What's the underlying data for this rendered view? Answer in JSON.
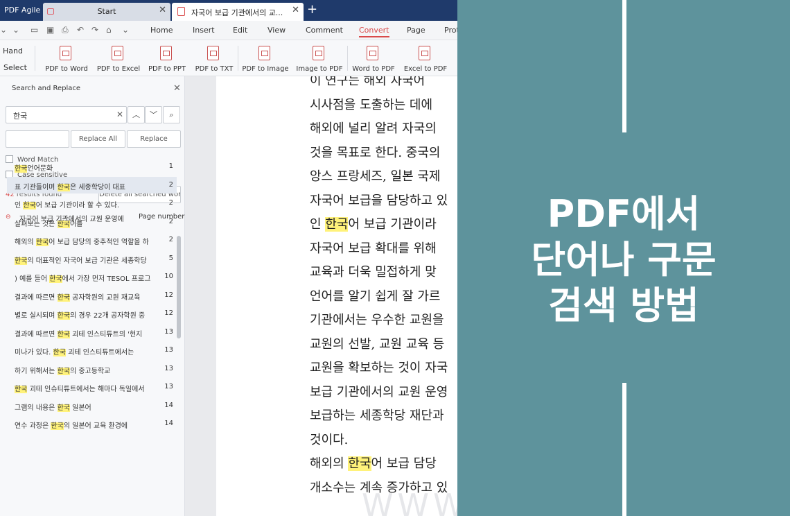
{
  "titlebar": {
    "app_name": "PDF Agile",
    "tabs": [
      {
        "label": "Start"
      },
      {
        "label": "자국어 보급 기관에서의 교..."
      }
    ]
  },
  "menubar": {
    "items": [
      "Home",
      "Insert",
      "Edit",
      "View",
      "Comment",
      "Convert",
      "Page",
      "Prot"
    ],
    "active": "Convert"
  },
  "ribbon": {
    "hand_label": "Hand",
    "select_label": "Select",
    "tools": [
      "PDF to Word",
      "PDF to Excel",
      "PDF to PPT",
      "PDF to TXT",
      "PDF to Image",
      "Image to PDF",
      "Word to PDF",
      "Excel to PDF"
    ]
  },
  "search_panel": {
    "title": "Search and Replace",
    "query": "한국",
    "replace_all_label": "Replace All",
    "replace_label": "Replace",
    "word_match_label": "Word Match",
    "case_sensitive_label": "Case sensitive",
    "results_num": "42",
    "results_suffix": " results found",
    "delete_label": "Delete all searched words",
    "group_name": "자국어 보급 기관에서의 교원 운영에",
    "page_header": "Page number",
    "results": [
      {
        "before": "",
        "match": "한국",
        "after": "언어문화",
        "page": "1"
      },
      {
        "before": "표 기관들이며 ",
        "match": "한국",
        "after": "은 세종학당이 대표",
        "page": "2"
      },
      {
        "before": "인 ",
        "match": "한국",
        "after": "어 보급 기관이라 할 수 있다.",
        "page": "2"
      },
      {
        "before": "살펴보는 것은 ",
        "match": "한국",
        "after": "어를",
        "page": "2"
      },
      {
        "before": "해외의 ",
        "match": "한국",
        "after": "어 보급 담당의 중추적인 역할을 하",
        "page": "2"
      },
      {
        "before": "",
        "match": "한국",
        "after": "의 대표적인 자국어 보급 기관은 세종학당",
        "page": "5"
      },
      {
        "before": ") 예를 들어 ",
        "match": "한국",
        "after": "에서 가장 먼저 TESOL 프로그",
        "page": "10"
      },
      {
        "before": "결과에 따르면 ",
        "match": "한국",
        "after": " 공자학원의 교원 재교육",
        "page": "12"
      },
      {
        "before": "별로 실시되며 ",
        "match": "한국",
        "after": "의 경우 22개 공자학원 중",
        "page": "12"
      },
      {
        "before": "결과에 따르면 ",
        "match": "한국",
        "after": " 괴테 인스티튜트의 '현지",
        "page": "13"
      },
      {
        "before": "미나가 있다. ",
        "match": "한국",
        "after": " 괴테 인스티튜트에서는",
        "page": "13"
      },
      {
        "before": "하기 위해서는 ",
        "match": "한국",
        "after": "의 중고등학교",
        "page": "13"
      },
      {
        "before": "",
        "match": "한국",
        "after": " 괴테 인슈티튜트에서는 해마다 독일에서",
        "page": "13"
      },
      {
        "before": "그램의 내용은 ",
        "match": "한국",
        "after": " 일본어",
        "page": "14"
      },
      {
        "before": "연수 과정은 ",
        "match": "한국",
        "after": "의 일본어 교육 환경에",
        "page": "14"
      }
    ]
  },
  "document": {
    "lines": [
      {
        "pre": "이 연구는 해외 자국어",
        "match": "",
        "post": ""
      },
      {
        "pre": "시사점을 도출하는 데에 ",
        "match": "",
        "post": ""
      },
      {
        "pre": "해외에 널리 알려 자국의",
        "match": "",
        "post": ""
      },
      {
        "pre": "것을 목표로 한다. 중국의",
        "match": "",
        "post": ""
      },
      {
        "pre": "앙스 프랑세즈, 일본 국제",
        "match": "",
        "post": ""
      },
      {
        "pre": "자국어 보급을 담당하고 있",
        "match": "",
        "post": ""
      },
      {
        "pre": "인 ",
        "match": "한국",
        "post": "어 보급 기관이라"
      },
      {
        "pre": "  자국어 보급 확대를 위해",
        "match": "",
        "post": ""
      },
      {
        "pre": "교육과 더욱 밀접하게 맞",
        "match": "",
        "post": ""
      },
      {
        "pre": "언어를 알기 쉽게 잘 가르",
        "match": "",
        "post": ""
      },
      {
        "pre": "기관에서는 우수한 교원을",
        "match": "",
        "post": ""
      },
      {
        "pre": "교원의 선발, 교원 교육 등",
        "match": "",
        "post": ""
      },
      {
        "pre": "교원을 확보하는 것이 자국",
        "match": "",
        "post": ""
      },
      {
        "pre": "보급 기관에서의 교원 운영",
        "match": "",
        "post": ""
      },
      {
        "pre": "보급하는 세종학당 재단과",
        "match": "",
        "post": ""
      },
      {
        "pre": "것이다.",
        "match": "",
        "post": ""
      },
      {
        "pre": "  해외의 ",
        "match": "한국",
        "post": "어 보급 담당"
      },
      {
        "pre": "개소수는 계속 증가하고 있",
        "match": "",
        "post": ""
      }
    ],
    "watermark": "WWW"
  },
  "overlay": {
    "headline_lines": [
      "PDF에서",
      "단어나 구문",
      "검색 방법"
    ],
    "background_color": "#5e939c"
  }
}
